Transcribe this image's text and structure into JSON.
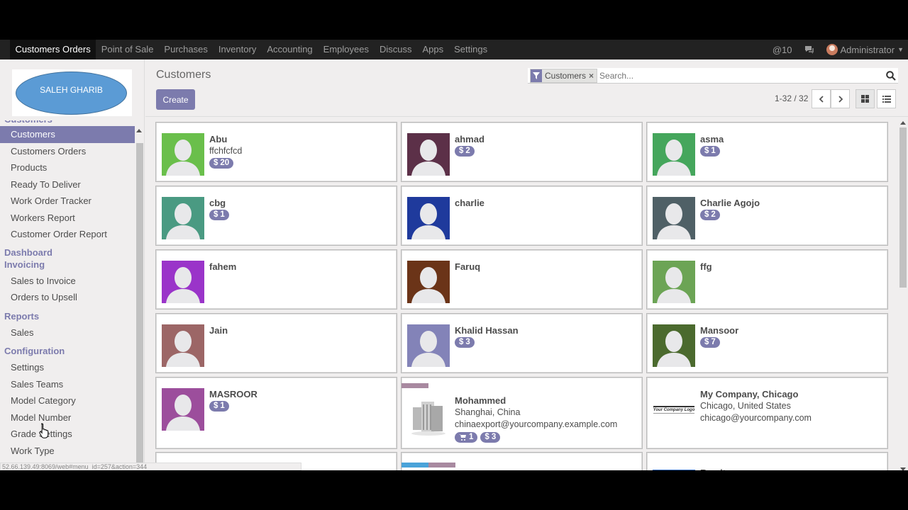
{
  "topnav": {
    "menu": [
      "Customers Orders",
      "Point of Sale",
      "Purchases",
      "Inventory",
      "Accounting",
      "Employees",
      "Discuss",
      "Apps",
      "Settings"
    ],
    "mentions": "@10",
    "user": "Administrator"
  },
  "sidebar": {
    "logo_text": "SALEH GHARIB",
    "cut_heading": "Customers",
    "sections": [
      {
        "heading": "",
        "items": [
          "Customers",
          "Customers Orders",
          "Products",
          "Ready To Deliver",
          "Work Order Tracker",
          "Workers Report",
          "Customer Order Report"
        ]
      },
      {
        "heading": "Dashboard",
        "items": []
      },
      {
        "heading": "Invoicing",
        "items": [
          "Sales to Invoice",
          "Orders to Upsell"
        ]
      },
      {
        "heading": "Reports",
        "items": [
          "Sales"
        ]
      },
      {
        "heading": "Configuration",
        "items": [
          "Settings",
          "Sales Teams",
          "Model Category",
          "Model Number",
          "Grade Settings",
          "Work Type"
        ]
      }
    ]
  },
  "control": {
    "title": "Customers",
    "create_label": "Create",
    "facet_label": "Customers",
    "search_placeholder": "Search...",
    "pager": "1-32 / 32"
  },
  "status_url": "52.66.139.49:8069/web#menu_id=257&action=344",
  "colors": {
    "accent": "#7c7bad",
    "nav_bg": "#222222"
  },
  "customers": [
    {
      "name": "Abu",
      "lines": [
        "ffchfcfcd"
      ],
      "badges": [
        {
          "icon": "dollar",
          "text": "20"
        }
      ],
      "avatar": "#6abf4b"
    },
    {
      "name": "ahmad",
      "lines": [],
      "badges": [
        {
          "icon": "dollar",
          "text": "2"
        }
      ],
      "avatar": "#5c3048"
    },
    {
      "name": "asma",
      "lines": [],
      "badges": [
        {
          "icon": "dollar",
          "text": "1"
        }
      ],
      "avatar": "#45a65c"
    },
    {
      "name": "cbg",
      "lines": [],
      "badges": [
        {
          "icon": "dollar",
          "text": "1"
        }
      ],
      "avatar": "#4a9a82"
    },
    {
      "name": "charlie",
      "lines": [],
      "badges": [],
      "avatar": "#1f3a9c"
    },
    {
      "name": "Charlie Agojo",
      "lines": [],
      "badges": [
        {
          "icon": "dollar",
          "text": "2"
        }
      ],
      "avatar": "#4f6066"
    },
    {
      "name": "fahem",
      "lines": [],
      "badges": [],
      "avatar": "#9a34c9"
    },
    {
      "name": "Faruq",
      "lines": [],
      "badges": [],
      "avatar": "#6b3418"
    },
    {
      "name": "ffg",
      "lines": [],
      "badges": [],
      "avatar": "#6ca455"
    },
    {
      "name": "Jain",
      "lines": [],
      "badges": [],
      "avatar": "#9c6666"
    },
    {
      "name": "Khalid Hassan",
      "lines": [],
      "badges": [
        {
          "icon": "dollar",
          "text": "3"
        }
      ],
      "avatar": "#8383b8"
    },
    {
      "name": "Mansoor",
      "lines": [],
      "badges": [
        {
          "icon": "dollar",
          "text": "7"
        }
      ],
      "avatar": "#4b6a2e"
    },
    {
      "name": "MASROOR",
      "lines": [],
      "badges": [
        {
          "icon": "dollar",
          "text": "1"
        }
      ],
      "avatar": "#9c4e9c"
    },
    {
      "name": "Mohammed",
      "lines": [
        "Shanghai, China",
        "chinaexport@yourcompany.example.com"
      ],
      "badges": [
        {
          "icon": "cart",
          "text": "1"
        },
        {
          "icon": "dollar",
          "text": "3"
        }
      ],
      "avatar": "company"
    },
    {
      "name": "My Company, Chicago",
      "lines": [
        "Chicago, United States",
        "chicago@yourcompany.com"
      ],
      "badges": [],
      "avatar": "logo"
    },
    {
      "name": "",
      "lines": [],
      "badges": [],
      "avatar": "none"
    },
    {
      "name": "",
      "lines": [],
      "badges": [],
      "avatar": "none"
    },
    {
      "name": "Ramit",
      "lines": [],
      "badges": [],
      "avatar": "#3a6fbf"
    }
  ],
  "logo_badge_text": "Your Company Logo"
}
